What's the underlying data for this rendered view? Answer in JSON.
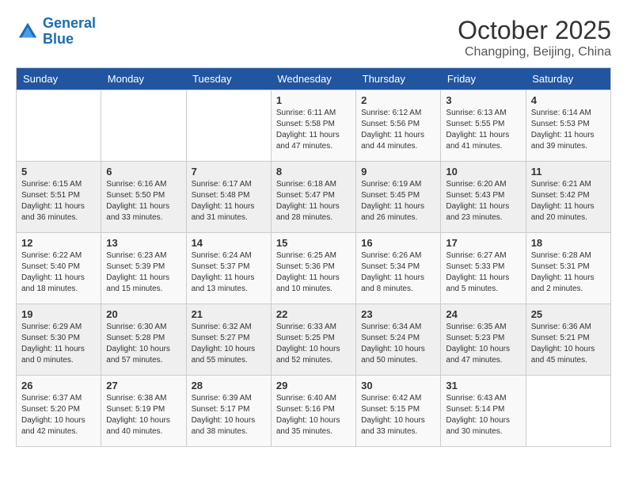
{
  "logo": {
    "line1": "General",
    "line2": "Blue"
  },
  "title": {
    "month_year": "October 2025",
    "location": "Changping, Beijing, China"
  },
  "headers": [
    "Sunday",
    "Monday",
    "Tuesday",
    "Wednesday",
    "Thursday",
    "Friday",
    "Saturday"
  ],
  "weeks": [
    [
      {
        "day": "",
        "info": ""
      },
      {
        "day": "",
        "info": ""
      },
      {
        "day": "",
        "info": ""
      },
      {
        "day": "1",
        "info": "Sunrise: 6:11 AM\nSunset: 5:58 PM\nDaylight: 11 hours and 47 minutes."
      },
      {
        "day": "2",
        "info": "Sunrise: 6:12 AM\nSunset: 5:56 PM\nDaylight: 11 hours and 44 minutes."
      },
      {
        "day": "3",
        "info": "Sunrise: 6:13 AM\nSunset: 5:55 PM\nDaylight: 11 hours and 41 minutes."
      },
      {
        "day": "4",
        "info": "Sunrise: 6:14 AM\nSunset: 5:53 PM\nDaylight: 11 hours and 39 minutes."
      }
    ],
    [
      {
        "day": "5",
        "info": "Sunrise: 6:15 AM\nSunset: 5:51 PM\nDaylight: 11 hours and 36 minutes."
      },
      {
        "day": "6",
        "info": "Sunrise: 6:16 AM\nSunset: 5:50 PM\nDaylight: 11 hours and 33 minutes."
      },
      {
        "day": "7",
        "info": "Sunrise: 6:17 AM\nSunset: 5:48 PM\nDaylight: 11 hours and 31 minutes."
      },
      {
        "day": "8",
        "info": "Sunrise: 6:18 AM\nSunset: 5:47 PM\nDaylight: 11 hours and 28 minutes."
      },
      {
        "day": "9",
        "info": "Sunrise: 6:19 AM\nSunset: 5:45 PM\nDaylight: 11 hours and 26 minutes."
      },
      {
        "day": "10",
        "info": "Sunrise: 6:20 AM\nSunset: 5:43 PM\nDaylight: 11 hours and 23 minutes."
      },
      {
        "day": "11",
        "info": "Sunrise: 6:21 AM\nSunset: 5:42 PM\nDaylight: 11 hours and 20 minutes."
      }
    ],
    [
      {
        "day": "12",
        "info": "Sunrise: 6:22 AM\nSunset: 5:40 PM\nDaylight: 11 hours and 18 minutes."
      },
      {
        "day": "13",
        "info": "Sunrise: 6:23 AM\nSunset: 5:39 PM\nDaylight: 11 hours and 15 minutes."
      },
      {
        "day": "14",
        "info": "Sunrise: 6:24 AM\nSunset: 5:37 PM\nDaylight: 11 hours and 13 minutes."
      },
      {
        "day": "15",
        "info": "Sunrise: 6:25 AM\nSunset: 5:36 PM\nDaylight: 11 hours and 10 minutes."
      },
      {
        "day": "16",
        "info": "Sunrise: 6:26 AM\nSunset: 5:34 PM\nDaylight: 11 hours and 8 minutes."
      },
      {
        "day": "17",
        "info": "Sunrise: 6:27 AM\nSunset: 5:33 PM\nDaylight: 11 hours and 5 minutes."
      },
      {
        "day": "18",
        "info": "Sunrise: 6:28 AM\nSunset: 5:31 PM\nDaylight: 11 hours and 2 minutes."
      }
    ],
    [
      {
        "day": "19",
        "info": "Sunrise: 6:29 AM\nSunset: 5:30 PM\nDaylight: 11 hours and 0 minutes."
      },
      {
        "day": "20",
        "info": "Sunrise: 6:30 AM\nSunset: 5:28 PM\nDaylight: 10 hours and 57 minutes."
      },
      {
        "day": "21",
        "info": "Sunrise: 6:32 AM\nSunset: 5:27 PM\nDaylight: 10 hours and 55 minutes."
      },
      {
        "day": "22",
        "info": "Sunrise: 6:33 AM\nSunset: 5:25 PM\nDaylight: 10 hours and 52 minutes."
      },
      {
        "day": "23",
        "info": "Sunrise: 6:34 AM\nSunset: 5:24 PM\nDaylight: 10 hours and 50 minutes."
      },
      {
        "day": "24",
        "info": "Sunrise: 6:35 AM\nSunset: 5:23 PM\nDaylight: 10 hours and 47 minutes."
      },
      {
        "day": "25",
        "info": "Sunrise: 6:36 AM\nSunset: 5:21 PM\nDaylight: 10 hours and 45 minutes."
      }
    ],
    [
      {
        "day": "26",
        "info": "Sunrise: 6:37 AM\nSunset: 5:20 PM\nDaylight: 10 hours and 42 minutes."
      },
      {
        "day": "27",
        "info": "Sunrise: 6:38 AM\nSunset: 5:19 PM\nDaylight: 10 hours and 40 minutes."
      },
      {
        "day": "28",
        "info": "Sunrise: 6:39 AM\nSunset: 5:17 PM\nDaylight: 10 hours and 38 minutes."
      },
      {
        "day": "29",
        "info": "Sunrise: 6:40 AM\nSunset: 5:16 PM\nDaylight: 10 hours and 35 minutes."
      },
      {
        "day": "30",
        "info": "Sunrise: 6:42 AM\nSunset: 5:15 PM\nDaylight: 10 hours and 33 minutes."
      },
      {
        "day": "31",
        "info": "Sunrise: 6:43 AM\nSunset: 5:14 PM\nDaylight: 10 hours and 30 minutes."
      },
      {
        "day": "",
        "info": ""
      }
    ]
  ]
}
